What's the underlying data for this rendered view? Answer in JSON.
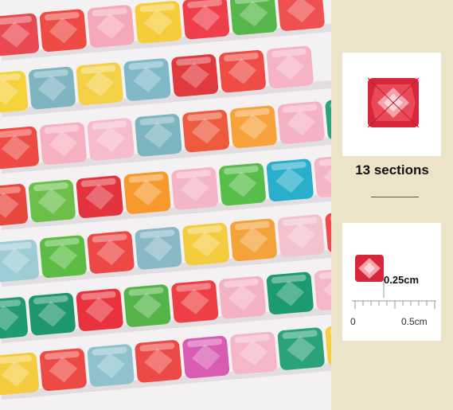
{
  "info_panel": {
    "sections_text": "13 sections",
    "size_text": "0.25cm",
    "ruler_start": "0",
    "ruler_end": "0.5cm"
  },
  "colors": {
    "background": "#ece3c8",
    "card": "#ffffff",
    "sample_gem": "#d8263a"
  },
  "photo": {
    "subject": "rows of colorful square faceted resin diamond-painting drills on a white tray",
    "row_colors": [
      [
        "#e94a52",
        "#ee4b45",
        "#f5a9b8",
        "#f6cc3b",
        "#ef3f4a",
        "#58b74a",
        "#ef5050"
      ],
      [
        "#f5d13a",
        "#7fb5c0",
        "#f4d046",
        "#7fb9c8",
        "#e03a3e",
        "#ef4c45",
        "#f5b3c3"
      ],
      [
        "#ef4b45",
        "#f7b0c0",
        "#f6bccb",
        "#7cb5bf",
        "#ee5a3e",
        "#f7a23a",
        "#f5b2c4",
        "#2ba27a"
      ],
      [
        "#e8473e",
        "#6cc04a",
        "#e2333e",
        "#f79a2b",
        "#f4b5c5",
        "#58be4a",
        "#29aecb",
        "#f4b5c4"
      ],
      [
        "#9cccd4",
        "#5cbc44",
        "#ec4845",
        "#8ab9c6",
        "#f4cc3f",
        "#f4a23a",
        "#f3c2cd",
        "#ef4a4e"
      ],
      [
        "#1f9a73",
        "#1e9670",
        "#e8333e",
        "#55b448",
        "#ee4044",
        "#f4b3c3",
        "#1c9a72",
        "#f5b7c6"
      ],
      [
        "#f4cc3e",
        "#ed4a45",
        "#8fc2cd",
        "#ec4a47",
        "#d85cb2",
        "#f5b6c8",
        "#2aa37a",
        "#f4cf45"
      ]
    ]
  }
}
